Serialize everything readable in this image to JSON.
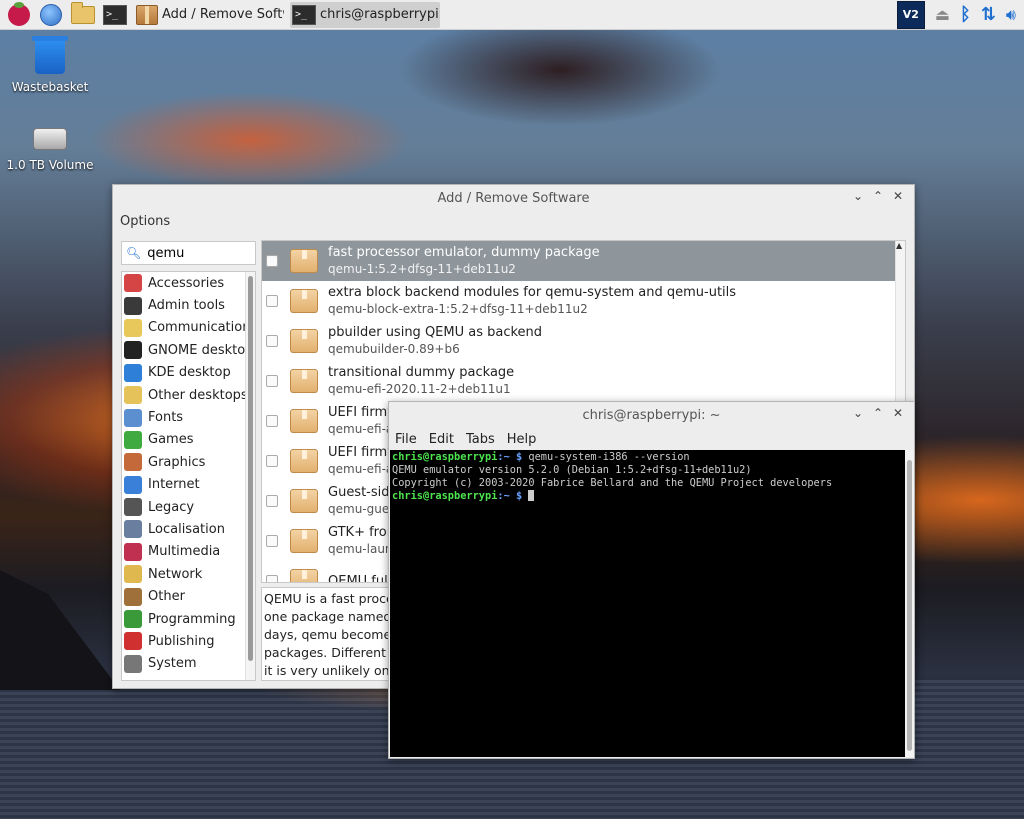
{
  "taskbar": {
    "apps": [
      {
        "icon": "raspberry-menu-icon"
      },
      {
        "icon": "globe-icon"
      },
      {
        "icon": "folder-icon"
      },
      {
        "icon": "terminal-icon"
      }
    ],
    "tasks": [
      {
        "label": "Add / Remove Softw...",
        "icon": "package-icon",
        "active": false
      },
      {
        "label": "chris@raspberrypi: ~",
        "icon": "terminal-icon",
        "active": true
      }
    ],
    "tray": {
      "vnc_label": "V2",
      "icons": [
        "vnc-icon",
        "eject-icon",
        "bluetooth-icon",
        "network-icon",
        "volume-icon"
      ]
    }
  },
  "desktop": {
    "icons": [
      {
        "label": "Wastebasket",
        "icon": "wastebasket-icon"
      },
      {
        "label": "1.0 TB Volume",
        "icon": "drive-icon"
      }
    ]
  },
  "addremove": {
    "title": "Add / Remove Software",
    "menu": "Options",
    "search_value": "qemu",
    "categories": [
      {
        "label": "Accessories",
        "color": "#d64545"
      },
      {
        "label": "Admin tools",
        "color": "#3a3a3a"
      },
      {
        "label": "Communication",
        "color": "#e8c85a"
      },
      {
        "label": "GNOME desktop",
        "color": "#222222"
      },
      {
        "label": "KDE desktop",
        "color": "#2d7fd8"
      },
      {
        "label": "Other desktops",
        "color": "#e6c35a"
      },
      {
        "label": "Fonts",
        "color": "#5b8fd0"
      },
      {
        "label": "Games",
        "color": "#3faa3f"
      },
      {
        "label": "Graphics",
        "color": "#c46a3a"
      },
      {
        "label": "Internet",
        "color": "#3a80d8"
      },
      {
        "label": "Legacy",
        "color": "#555555"
      },
      {
        "label": "Localisation",
        "color": "#6a7fa0"
      },
      {
        "label": "Multimedia",
        "color": "#c03050"
      },
      {
        "label": "Network",
        "color": "#e0b850"
      },
      {
        "label": "Other",
        "color": "#a0703a"
      },
      {
        "label": "Programming",
        "color": "#3a9a3a"
      },
      {
        "label": "Publishing",
        "color": "#d03030"
      },
      {
        "label": "System",
        "color": "#777777"
      }
    ],
    "packages": [
      {
        "desc": "fast processor emulator, dummy package",
        "version": "qemu-1:5.2+dfsg-11+deb11u2",
        "selected": true
      },
      {
        "desc": "extra block backend modules for qemu-system and qemu-utils",
        "version": "qemu-block-extra-1:5.2+dfsg-11+deb11u2",
        "selected": false
      },
      {
        "desc": "pbuilder using QEMU as backend",
        "version": "qemubuilder-0.89+b6",
        "selected": false
      },
      {
        "desc": "transitional dummy package",
        "version": "qemu-efi-2020.11-2+deb11u1",
        "selected": false
      },
      {
        "desc": "UEFI firmwa",
        "version": "qemu-efi-aa",
        "selected": false
      },
      {
        "desc": "UEFI firmwa",
        "version": "qemu-efi-ar",
        "selected": false
      },
      {
        "desc": "Guest-side",
        "version": "qemu-guest",
        "selected": false
      },
      {
        "desc": "GTK+ front-",
        "version": "qemu-launc",
        "selected": false
      },
      {
        "desc": "QEMU full s",
        "version": "",
        "selected": false
      }
    ],
    "description_lines": [
      "QEMU is a fast proces",
      "one package named q",
      "days, qemu become la",
      "packages. Different pa",
      "it is very unlikely one w"
    ]
  },
  "terminal": {
    "title": "chris@raspberrypi: ~",
    "menu": [
      "File",
      "Edit",
      "Tabs",
      "Help"
    ],
    "prompt_user": "chris@raspberrypi",
    "prompt_path": ":~",
    "prompt_symbol": " $ ",
    "command": "qemu-system-i386 --version",
    "output": [
      "QEMU emulator version 5.2.0 (Debian 1:5.2+dfsg-11+deb11u2)",
      "Copyright (c) 2003-2020 Fabrice Bellard and the QEMU Project developers"
    ]
  }
}
